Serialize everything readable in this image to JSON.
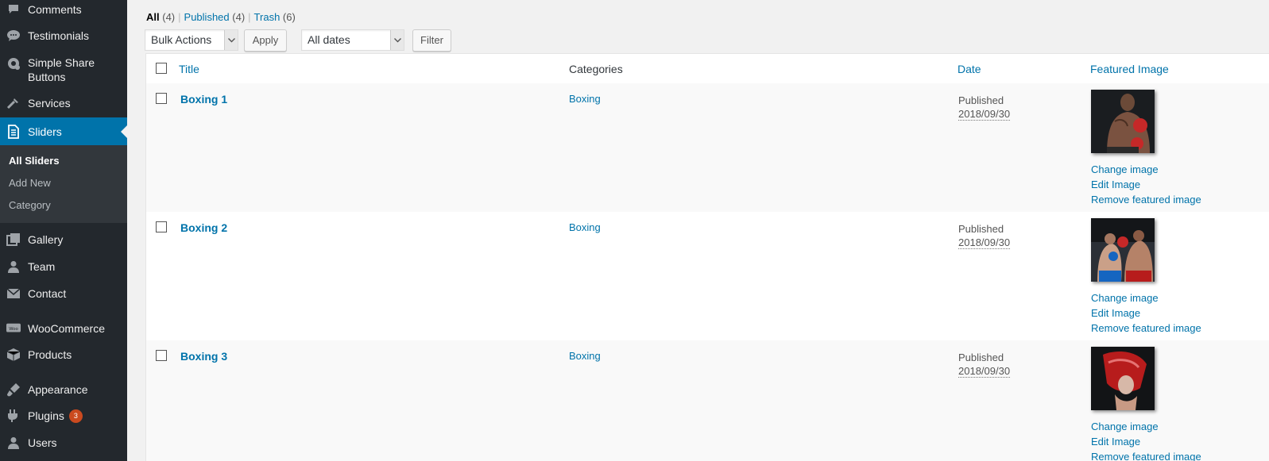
{
  "sidebar": {
    "items": [
      {
        "label": "Comments",
        "icon": "comment-icon"
      },
      {
        "label": "Testimonials",
        "icon": "comments-icon"
      },
      {
        "label": "Simple Share",
        "label2": "Buttons",
        "icon": "share-icon"
      },
      {
        "label": "Services",
        "icon": "tools-icon"
      },
      {
        "label": "Sliders",
        "icon": "page-icon"
      },
      {
        "label": "Gallery",
        "icon": "gallery-icon"
      },
      {
        "label": "Team",
        "icon": "person-icon"
      },
      {
        "label": "Contact",
        "icon": "envelope-icon"
      },
      {
        "label": "WooCommerce",
        "icon": "woo-icon"
      },
      {
        "label": "Products",
        "icon": "box-icon"
      },
      {
        "label": "Appearance",
        "icon": "brush-icon"
      },
      {
        "label": "Plugins",
        "icon": "plugin-icon",
        "badge": "3"
      },
      {
        "label": "Users",
        "icon": "user-icon"
      }
    ],
    "submenu": [
      "All Sliders",
      "Add New",
      "Category"
    ]
  },
  "filters": {
    "all": "All",
    "all_count": "(4)",
    "published": "Published",
    "published_count": "(4)",
    "trash": "Trash",
    "trash_count": "(6)",
    "sep": "|"
  },
  "toolbar": {
    "bulk_actions": "Bulk Actions",
    "apply": "Apply",
    "dates": "All dates",
    "filter": "Filter"
  },
  "table": {
    "columns": {
      "title": "Title",
      "categories": "Categories",
      "date": "Date",
      "featured_image": "Featured Image"
    },
    "rows": [
      {
        "title": "Boxing 1",
        "category": "Boxing",
        "status": "Published",
        "date": "2018/09/30"
      },
      {
        "title": "Boxing 2",
        "category": "Boxing",
        "status": "Published",
        "date": "2018/09/30"
      },
      {
        "title": "Boxing 3",
        "category": "Boxing",
        "status": "Published",
        "date": "2018/09/30"
      }
    ],
    "image_actions": {
      "change": "Change image",
      "edit": "Edit Image",
      "remove": "Remove featured image"
    }
  },
  "colors": {
    "sidebar_bg": "#23282d",
    "accent": "#0073aa",
    "badge": "#ca4a1f"
  }
}
